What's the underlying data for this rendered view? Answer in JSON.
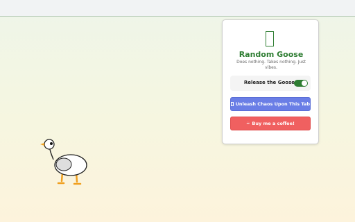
{
  "popup": {
    "title": "Random Goose",
    "tagline": "Does nothing. Takes nothing. Just vibes.",
    "icon": "goose-icon",
    "toggle": {
      "label": "Release the Goose",
      "state": "on"
    },
    "chaos_button": {
      "icon": "chaos-icon",
      "label": "Unleash Chaos Upon This Tab"
    },
    "coffee_button": {
      "icon": "coffee-icon",
      "label": "Buy me a coffee!"
    }
  },
  "colors": {
    "brand_green": "#2e7d32",
    "chaos_blue": "#6a7ee6",
    "coffee_red": "#f06060",
    "background_top": "#eef5e9",
    "background_bottom": "#fdf3dc"
  }
}
